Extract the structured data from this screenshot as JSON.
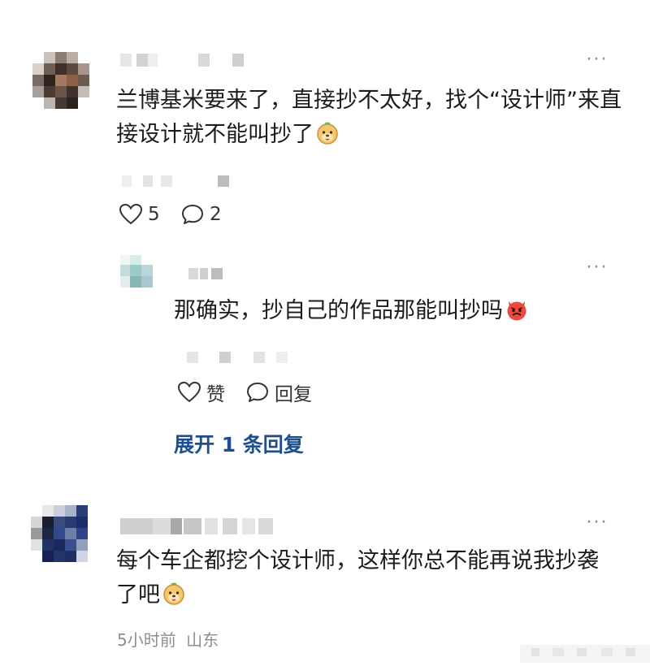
{
  "comments": [
    {
      "text": "兰博基米要来了，直接抄不太好，找个“设计师”来直接设计就不能叫抄了",
      "like_count": "5",
      "reply_count": "2",
      "reply": {
        "text": "那确实，抄自己的作品那能叫抄吗",
        "like_label": "赞",
        "reply_label": "回复"
      },
      "expand_label": "展开 1 条回复"
    },
    {
      "text": "每个车企都挖个设计师，这样你总不能再说我抄袭了吧",
      "time": "5小时前",
      "location": "山东"
    }
  ],
  "colors": {
    "link_blue": "#1f4e8c",
    "muted_gray": "#8d8d8d",
    "text": "#1c1c1c"
  },
  "icons": [
    "heart-icon",
    "comment-bubble-icon",
    "more-icon",
    "emoji-dog-icon",
    "emoji-devil-icon"
  ]
}
